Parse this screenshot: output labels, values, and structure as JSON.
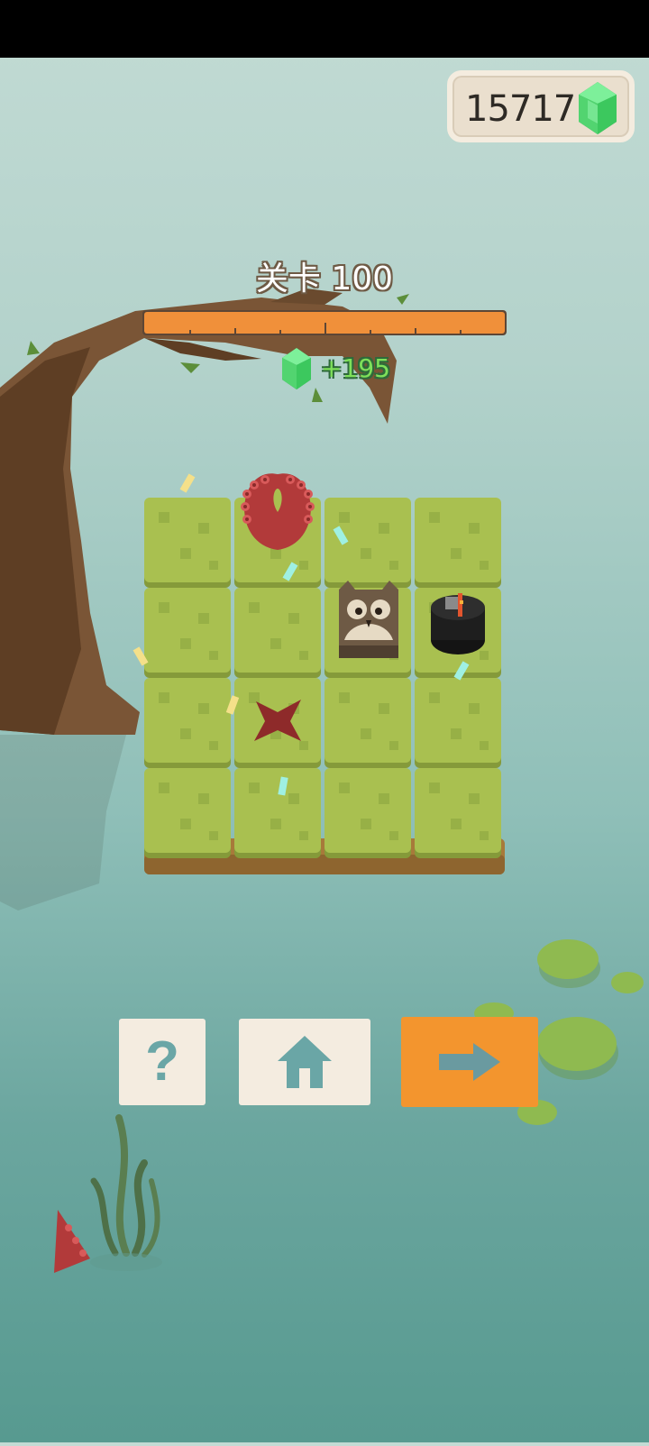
{
  "hud": {
    "gem_count": "15717",
    "gem_icon": "green-gem-icon"
  },
  "level": {
    "title": "关卡 100",
    "progress": 1.0,
    "reward_text": "+195"
  },
  "board": {
    "rows": 4,
    "cols": 4,
    "pieces": [
      {
        "name": "red-tentacle-pit",
        "row": 0,
        "col": 1
      },
      {
        "name": "owl-block-player",
        "row": 1,
        "col": 2
      },
      {
        "name": "black-bomb-pot",
        "row": 1,
        "col": 3
      },
      {
        "name": "red-target-star",
        "row": 2,
        "col": 1
      }
    ]
  },
  "buttons": {
    "help": {
      "label": "?",
      "icon": "question-icon"
    },
    "home": {
      "icon": "home-icon"
    },
    "next": {
      "icon": "arrow-right-icon"
    }
  },
  "colors": {
    "accent_orange": "#f3952e",
    "button_light": "#f4ece0",
    "grass": "#a9c050",
    "gem_green": "#48c862"
  }
}
